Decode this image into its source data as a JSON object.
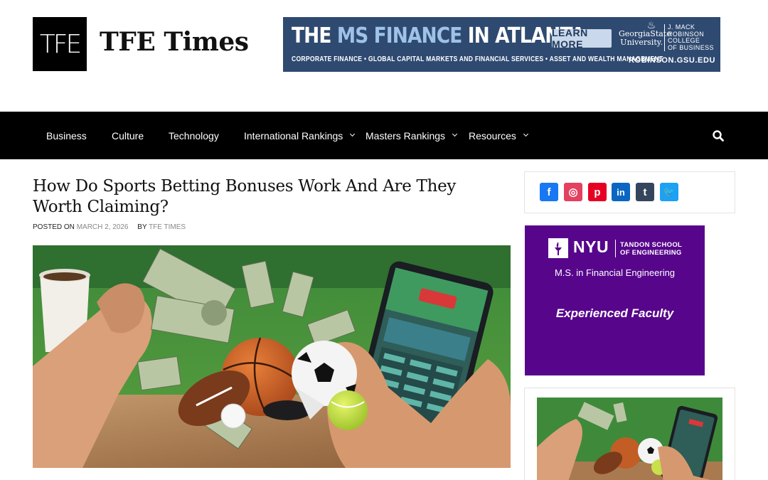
{
  "site": {
    "logo_mark": "TFE",
    "title": "TFE Times"
  },
  "banner": {
    "headline_pre": "THE ",
    "headline_highlight": "MS FINANCE",
    "headline_post": " IN ATLANTA.",
    "cta": "LEARN MORE",
    "subline": "CORPORATE FINANCE • GLOBAL CAPITAL MARKETS AND FINANCIAL SERVICES • ASSET AND WEALTH MANAGEMENT",
    "university_line1": "GeorgiaState",
    "university_line2": "University.",
    "college_lines": [
      "J. MACK",
      "ROBINSON",
      "COLLEGE",
      "OF BUSINESS"
    ],
    "url": "ROBINSON.GSU.EDU",
    "color": "#2f4a71"
  },
  "nav": {
    "items": [
      {
        "label": "Business",
        "has_dropdown": false
      },
      {
        "label": "Culture",
        "has_dropdown": false
      },
      {
        "label": "Technology",
        "has_dropdown": false
      },
      {
        "label": "International Rankings",
        "has_dropdown": true
      },
      {
        "label": "Masters Rankings",
        "has_dropdown": true
      },
      {
        "label": "Resources",
        "has_dropdown": true
      }
    ],
    "search_icon": "search-icon"
  },
  "article": {
    "title_line1": "How Do Sports Betting Bonuses Work And Are They",
    "title_line2": "Worth Claiming?",
    "posted_on_label": "POSTED ON",
    "date": "MARCH 2, 2026",
    "by_label": "BY",
    "author": "TFE TIMES",
    "image_icon": "sports-betting-image"
  },
  "sidebar": {
    "share_buttons": [
      {
        "name": "Facebook",
        "icon": "facebook-icon",
        "glyph": "f",
        "color": "#1877f2"
      },
      {
        "name": "Instagram",
        "icon": "instagram-icon",
        "glyph": "◎",
        "color": "#e4405f"
      },
      {
        "name": "Pinterest",
        "icon": "pinterest-icon",
        "glyph": "p",
        "color": "#e60023"
      },
      {
        "name": "LinkedIn",
        "icon": "linkedin-icon",
        "glyph": "in",
        "color": "#0a66c2"
      },
      {
        "name": "Tumblr",
        "icon": "tumblr-icon",
        "glyph": "t",
        "color": "#35465c"
      },
      {
        "name": "Twitter",
        "icon": "twitter-icon",
        "glyph": "🐦",
        "color": "#1da1f2"
      }
    ],
    "nyu_ad": {
      "wordmark": "NYU",
      "school_line1": "TANDON SCHOOL",
      "school_line2": "OF ENGINEERING",
      "program": "M.S. in Financial Engineering",
      "tagline": "Experienced Faculty",
      "color": "#57068c"
    }
  }
}
